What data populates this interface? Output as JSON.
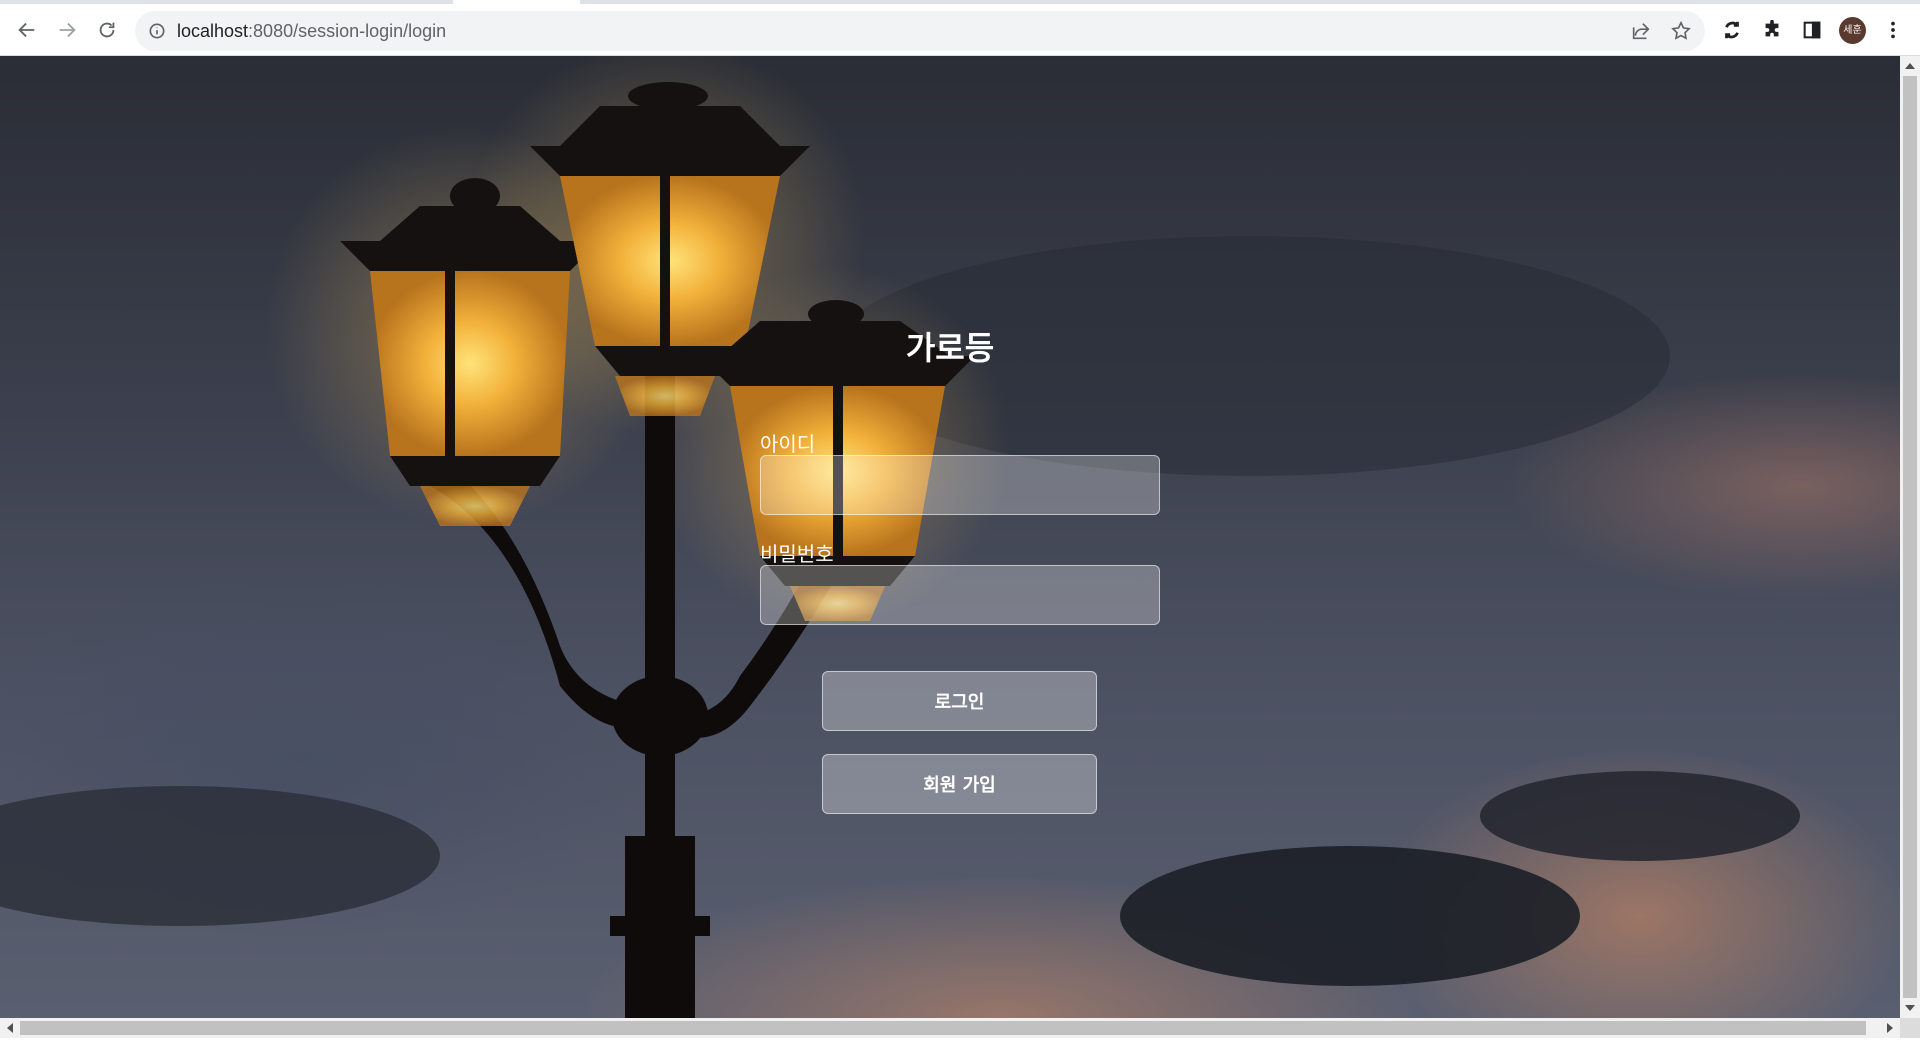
{
  "browser": {
    "url_host": "localhost",
    "url_rest": ":8080/session-login/login",
    "avatar_text": "세훈",
    "icons": {
      "back": "arrow-left-icon",
      "forward": "arrow-right-icon",
      "reload": "reload-icon",
      "site_info": "info-icon",
      "share": "share-icon",
      "bookmark": "star-icon",
      "sync": "sync-icon",
      "extensions": "puzzle-icon",
      "side_panel": "side-panel-icon",
      "menu": "kebab-menu-icon"
    }
  },
  "login": {
    "title": "가로등",
    "id_label": "아이디",
    "id_value": "",
    "password_label": "비밀번호",
    "password_value": "",
    "login_button": "로그인",
    "signup_button": "회원 가입"
  },
  "background": {
    "description_icon": "street-lamp-image",
    "lamp_glow_color": "#f5c24a",
    "sky_color": "#3b3f4c"
  }
}
